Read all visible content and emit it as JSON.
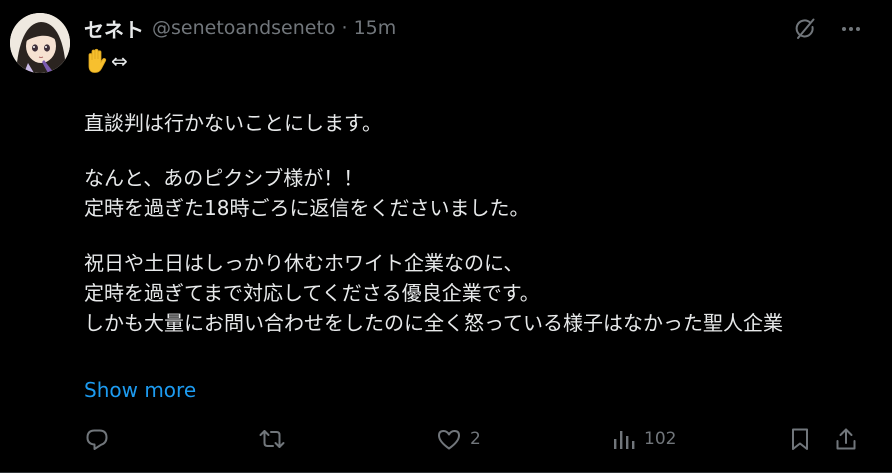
{
  "tweet": {
    "display_name": "セネト",
    "handle": "@senetoandseneto",
    "separator": "·",
    "time": "15m",
    "status_arrow": "⇔",
    "lines": [
      "直談判は行かないことにします。",
      "なんと、あのピクシブ様が！！",
      "定時を過ぎた18時ごろに返信をくださいました。",
      "祝日や土日はしっかり休むホワイト企業なのに、",
      "定時を過ぎてまで対応してくださる優良企業です。",
      "しかも大量にお問い合わせをしたのに全く怒っている様子はなかった聖人企業"
    ],
    "show_more": "Show more"
  },
  "actions": {
    "reply_count": "",
    "retweet_count": "",
    "like_count": "2",
    "views_count": "102"
  },
  "icons": {
    "top": [
      "grok-icon",
      "more-icon"
    ],
    "actions": [
      "reply-icon",
      "retweet-icon",
      "like-icon",
      "views-icon",
      "bookmark-icon",
      "share-icon"
    ]
  },
  "colors": {
    "background": "#000000",
    "text": "#e7e9ea",
    "secondary": "#71767b",
    "link": "#1d9bf0"
  }
}
